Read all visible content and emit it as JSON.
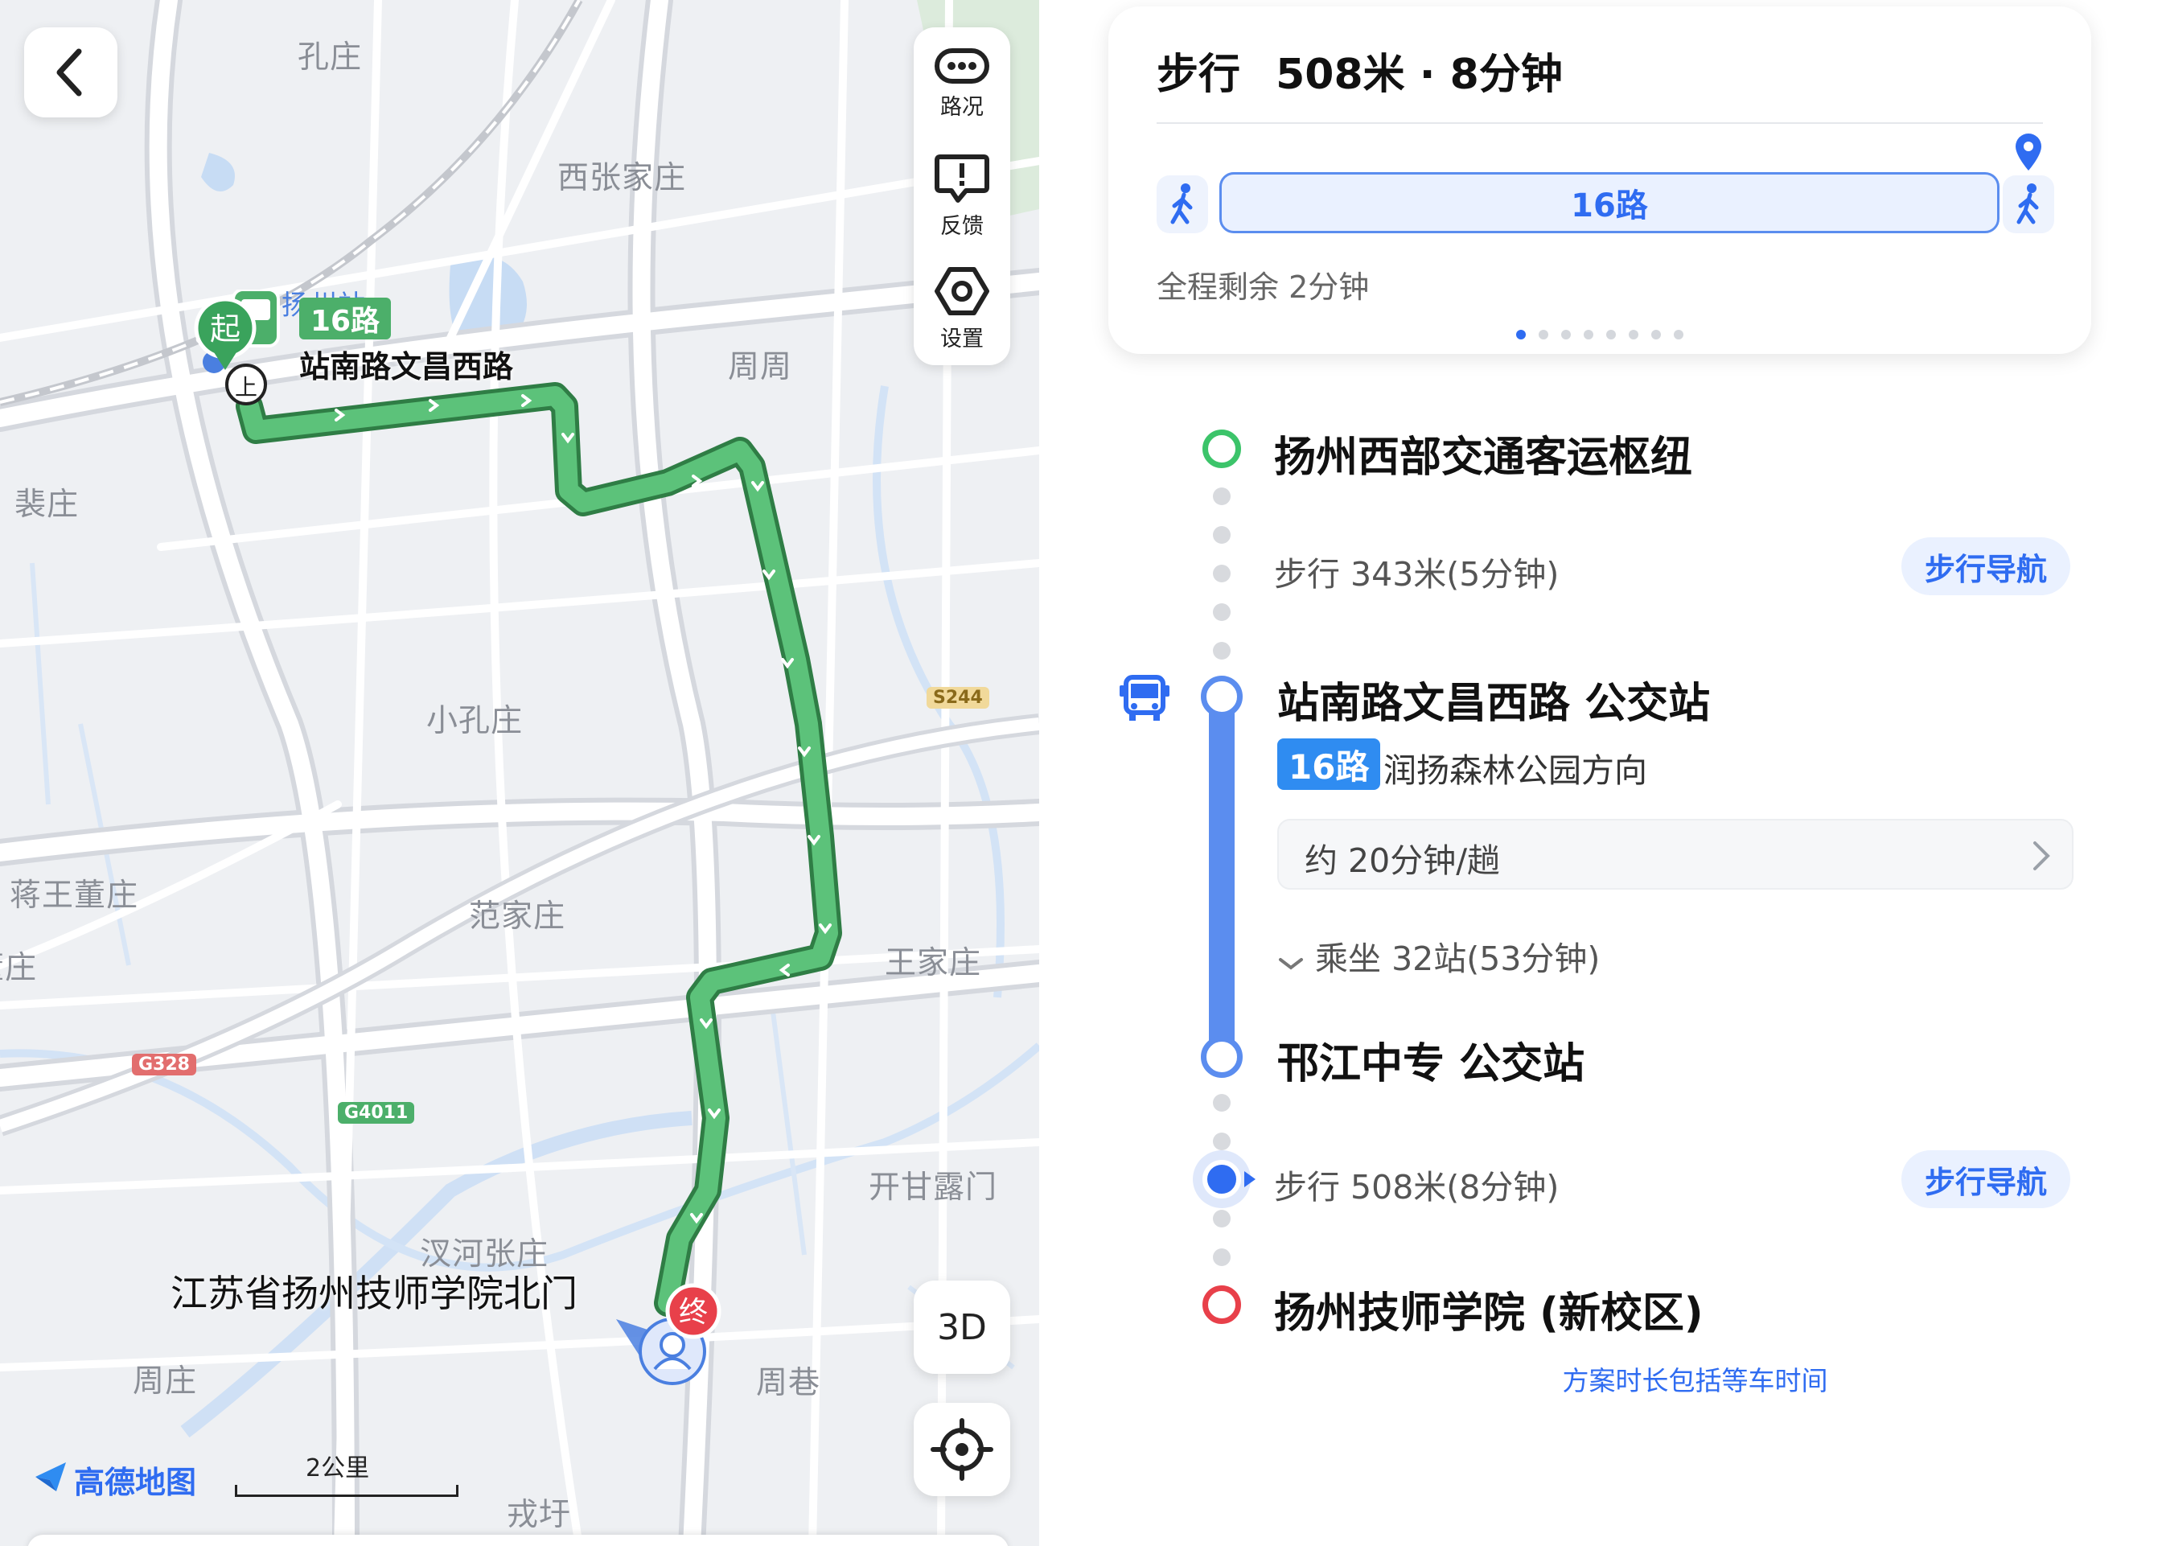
{
  "map": {
    "places": [
      "孔庄",
      "西张家庄",
      "周周",
      "裴庄",
      "小孔庄",
      "蒋王董庄",
      "范家庄",
      "王家庄",
      "董庄",
      "开甘露门",
      "汊河张庄",
      "周庄",
      "周巷",
      "戎圩",
      "扬州站"
    ],
    "highway_labels": [
      "S244",
      "G328",
      "G4011"
    ],
    "route_badge": "16路",
    "start_stop_label": "站南路文昌西路",
    "start_marker": "起",
    "board_marker": "上",
    "end_marker": "终",
    "destination_label": "江苏省扬州技师学院北门",
    "tools": [
      {
        "label": "路况",
        "icon": "traffic-icon"
      },
      {
        "label": "反馈",
        "icon": "feedback-icon"
      },
      {
        "label": "设置",
        "icon": "settings-icon"
      }
    ],
    "btn_3d": "3D",
    "brand": "高德地图",
    "scale": "2公里",
    "colors": {
      "route": "#4caf6a",
      "route_border": "#2f7d45",
      "start": "#3aa35c",
      "end": "#e8404a"
    }
  },
  "summary": {
    "title_mode": "步行",
    "title_distance": "508米",
    "title_time": "8分钟",
    "bus_bar_label": "16路",
    "remaining": "全程剩余 2分钟",
    "page_count": 8,
    "active_page": 0
  },
  "itinerary": {
    "origin": "扬州西部交通客运枢纽",
    "walk1": "步行 343米(5分钟)",
    "walk1_nav": "步行导航",
    "board_stop": "站南路文昌西路 公交站",
    "line_badge": "16路",
    "direction": "润扬森林公园方向",
    "frequency": "约 20分钟/趟",
    "ride": "乘坐 32站(53分钟)",
    "alight_stop": "邗江中专 公交站",
    "walk2": "步行 508米(8分钟)",
    "walk2_nav": "步行导航",
    "destination": "扬州技师学院 (新校区)",
    "footnote": "方案时长包括等车时间",
    "colors": {
      "bus_line": "#5b8def",
      "origin": "#3cc46a",
      "destination": "#e8404a",
      "accent": "#2f6cf1"
    }
  }
}
